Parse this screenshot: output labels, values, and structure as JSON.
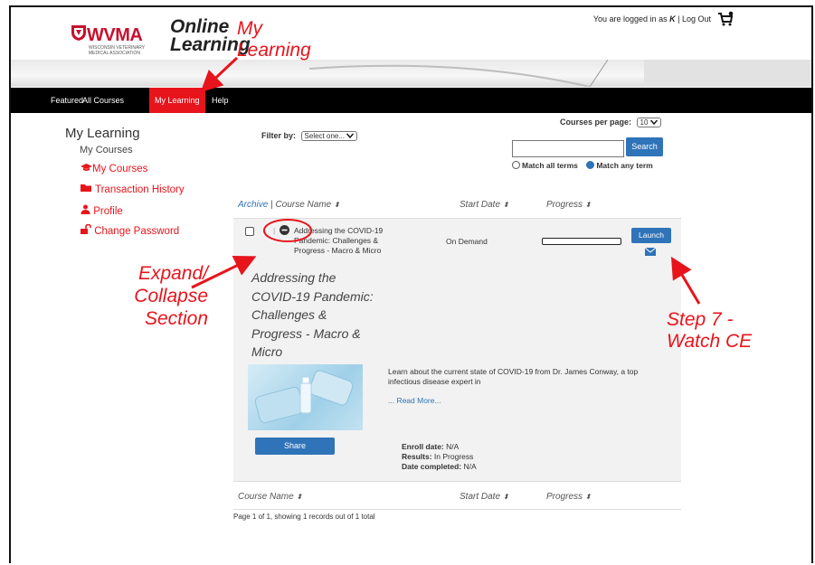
{
  "logo": {
    "brand": "WVMA",
    "subtitle": "WISCONSIN VETERINARY MEDICAL ASSOCIATION",
    "product": "Online Learning",
    "product_line1": "Online",
    "product_line2": "Learning"
  },
  "userbar": {
    "prefix": "You are logged in as",
    "user": "K",
    "separator": "|",
    "logout": "Log Out",
    "cart_icon": "cart-icon"
  },
  "nav": {
    "items": [
      "Featured",
      "All Courses",
      "My Learning",
      "Help"
    ],
    "active": "My Learning"
  },
  "sidebar": {
    "title": "My Learning",
    "subtitle": "My Courses",
    "links": [
      {
        "label": "My Courses",
        "icon": "graduation-cap-icon"
      },
      {
        "label": "Transaction History",
        "icon": "folder-icon"
      },
      {
        "label": "Profile",
        "icon": "user-icon"
      },
      {
        "label": "Change Password",
        "icon": "unlock-icon"
      }
    ]
  },
  "filter": {
    "label": "Filter by:",
    "value": "Select one..."
  },
  "perpage": {
    "label": "Courses per page:",
    "value": "10"
  },
  "search": {
    "button": "Search",
    "value": "",
    "match_all": "Match all terms",
    "match_any": "Match any term",
    "selected": "Match any term"
  },
  "table": {
    "header": {
      "archive": "Archive",
      "sep": "|",
      "course": "Course Name",
      "start": "Start Date",
      "progress": "Progress",
      "sort": "⬍"
    },
    "row": {
      "course_line1": "Addressing the COVID-19",
      "course_line2": "Pandemic: Challenges &",
      "course_line3": "Progress - Macro & Micro",
      "start": "On Demand",
      "progress": 0,
      "launch": "Launch",
      "details_title": [
        "Addressing the",
        "COVID-19 Pandemic:",
        "Challenges &",
        "Progress - Macro &",
        "Micro"
      ],
      "description1": "Learn about the current state of COVID-19 from Dr. James Conway, a top",
      "description2": "infectious disease expert in",
      "read_more": "... Read More...",
      "share": "Share",
      "enroll_label": "Enroll date:",
      "enroll_value": "N/A",
      "results_label": "Results:",
      "results_value": "In Progress",
      "completed_label": "Date completed:",
      "completed_value": "N/A"
    },
    "footer_header": {
      "course": "Course Name",
      "start": "Start Date",
      "progress": "Progress"
    },
    "pagination": "Page 1 of 1, showing 1 records out of 1 total"
  },
  "annotations": {
    "my_learning_line1": "My",
    "my_learning_line2": "Learning",
    "expand_line1": "Expand/",
    "expand_line2": "Collapse",
    "expand_line3": "Section",
    "step_line1": "Step 7 -",
    "step_line2": "Watch CE",
    "color": "#e8141c"
  }
}
